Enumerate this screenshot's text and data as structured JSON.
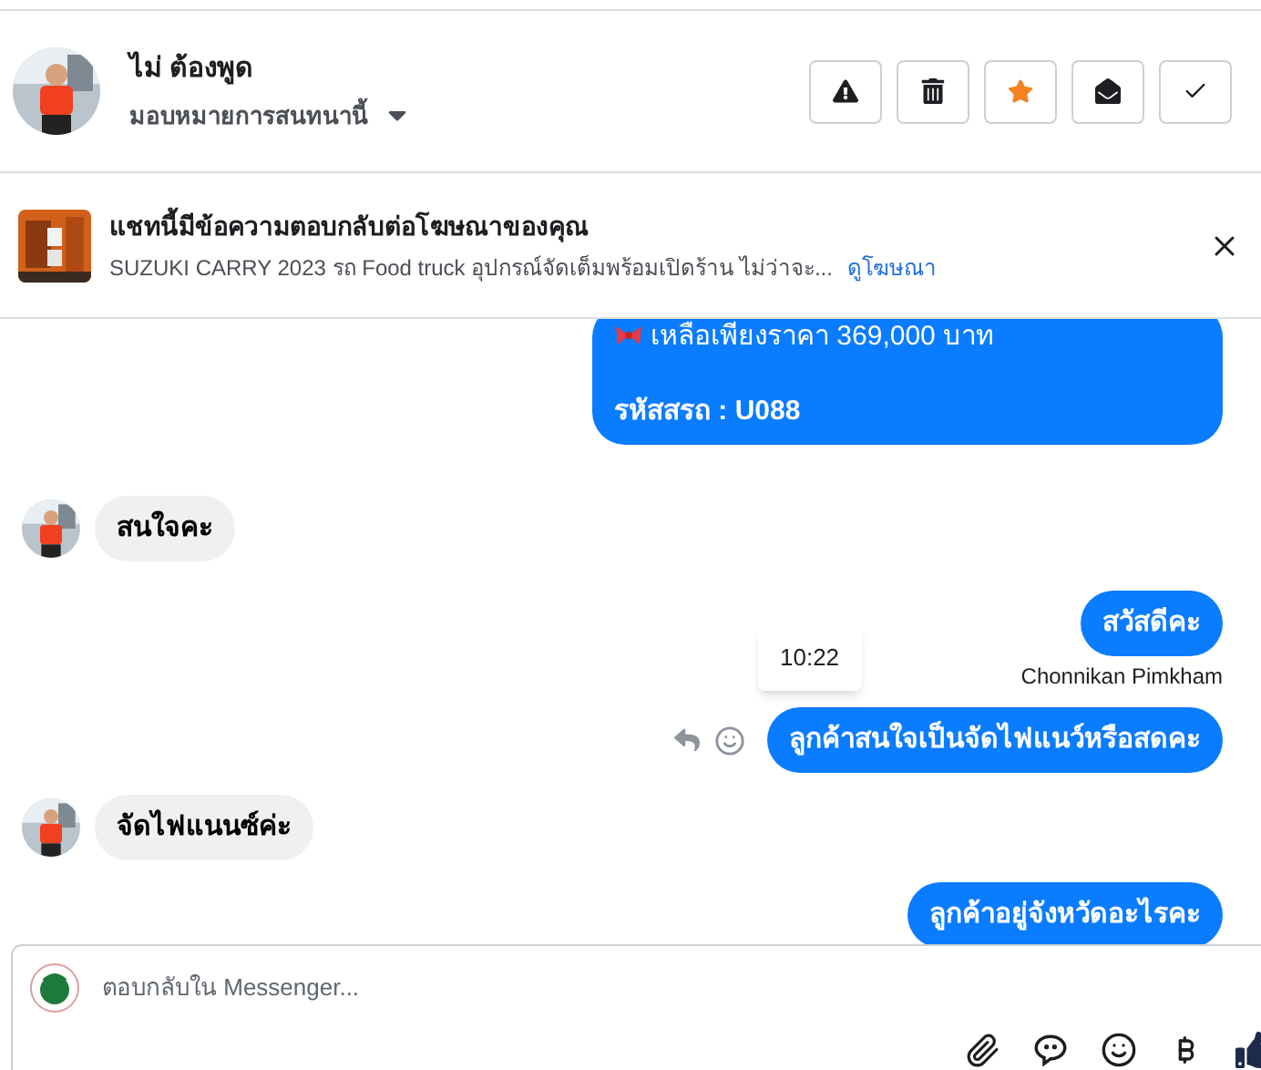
{
  "header": {
    "name": "ไม่ ต้องพูด",
    "assign_label": "มอบหมายการสนทนานี้",
    "actions": [
      {
        "kind": "alert",
        "on": false
      },
      {
        "kind": "delete",
        "on": false
      },
      {
        "kind": "star",
        "on": true
      },
      {
        "kind": "mark-read",
        "on": false
      },
      {
        "kind": "done",
        "on": false
      }
    ]
  },
  "ad_banner": {
    "title": "แชทนี้มีข้อความตอบกลับต่อโฆษณาของคุณ",
    "description": "SUZUKI CARRY 2023 รถ Food truck อุปกรณ์จัดเต็มพร้อมเปิดร้าน ไม่ว่าจะ...",
    "link": "ดูโฆษณา"
  },
  "messages": [
    {
      "kind": "outgoing",
      "lines": [
        "เหลือเพียงราคา 369,000 บาท",
        "รหัสสรถ : U088"
      ]
    },
    {
      "kind": "incoming",
      "lines": [
        "สนใจคะ"
      ]
    },
    {
      "kind": "outgoing",
      "lines": [
        "สวัสดีคะ"
      ],
      "sender": "Chonnikan Pimkham"
    },
    {
      "kind": "outgoing",
      "lines": [
        "ลูกค้าสนใจเป็นจัดไฟแนว์หรือสดคะ"
      ],
      "tooltip": "10:22"
    },
    {
      "kind": "incoming",
      "lines": [
        "จัดไฟแนนซ์ค่ะ"
      ]
    },
    {
      "kind": "outgoing",
      "lines": [
        "ลูกค้าอยู่จังหวัดอะไรคะ"
      ]
    }
  ],
  "composer": {
    "placeholder": "ตอบกลับใน Messenger..."
  }
}
